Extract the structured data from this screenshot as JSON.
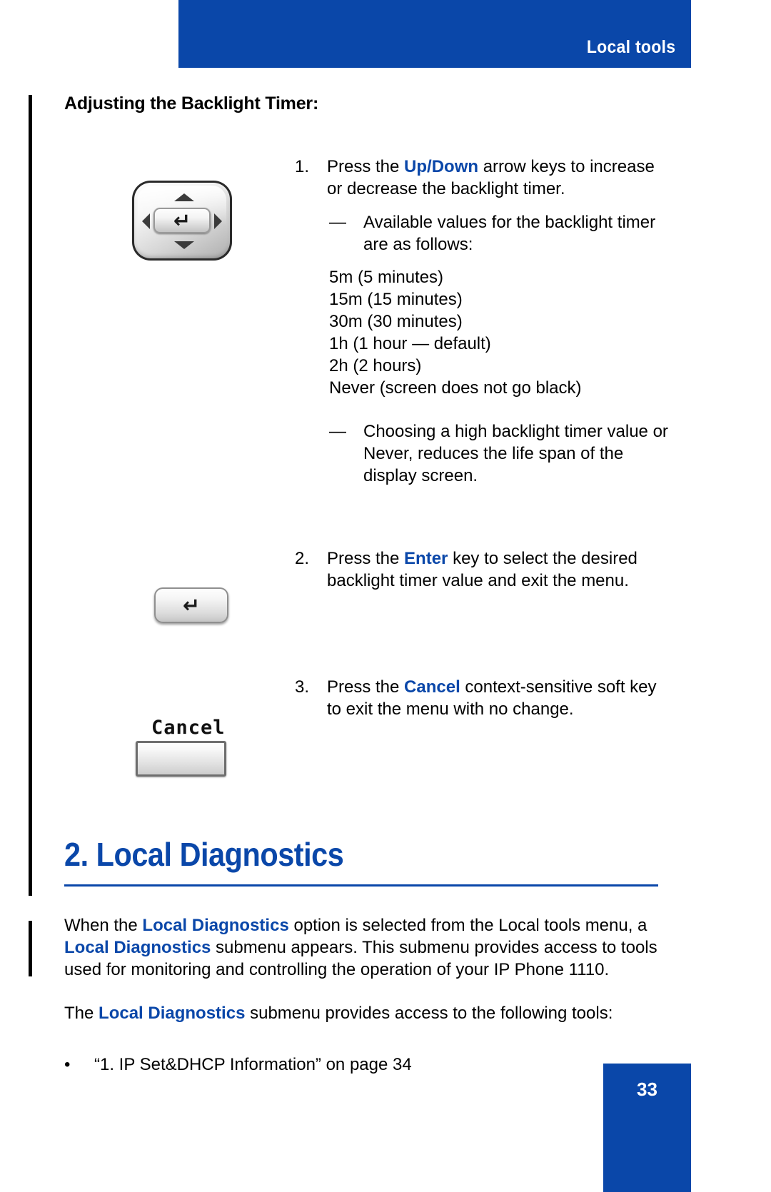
{
  "header": {
    "title": "Local tools",
    "bar_color": "#0a47a9"
  },
  "sub_heading": "Adjusting the Backlight Timer:",
  "steps": [
    {
      "number": "1.",
      "text_before": "Press the ",
      "highlight": "Up/Down",
      "text_after": " arrow keys to increase or decrease the backlight timer."
    },
    {
      "number": "2.",
      "text_before": "Press the ",
      "highlight": "Enter",
      "text_after": " key to select the desired backlight timer value and exit the menu."
    },
    {
      "number": "3.",
      "text_before": "Press the ",
      "highlight": "Cancel",
      "text_after": " context-sensitive soft key to exit the menu with no change."
    }
  ],
  "dash_notes": [
    {
      "mark": "—",
      "text": "Available values for the backlight timer are as follows:"
    },
    {
      "mark": "—",
      "text": "Choosing a high backlight timer value or Never, reduces the life span of the display screen."
    }
  ],
  "backlight_values": "5m (5 minutes)\n15m (15 minutes)\n30m (30 minutes)\n1h (1 hour — default)\n2h (2 hours)\nNever (screen does not go black)",
  "graphics": {
    "nav_cluster_name": "navigation-cluster-key-image",
    "enter_key_glyph": "↵",
    "cancel_softkey_label": "Cancel"
  },
  "section": {
    "heading": "2. Local Diagnostics",
    "paragraph1": {
      "p1": "When the ",
      "b1": "Local Diagnostics",
      "p2": " option is selected from the Local tools menu, a ",
      "b2": "Local Diagnostics",
      "p3": " submenu appears. This submenu provides access to tools used for monitoring and controlling the operation of your IP Phone 1110."
    },
    "paragraph2": {
      "p1": "The ",
      "b1": "Local Diagnostics",
      "p2": " submenu provides access to the following tools:"
    },
    "bullets": [
      {
        "mark": "•",
        "text": "“1. IP Set&DHCP Information” on page 34"
      }
    ]
  },
  "footer": {
    "page_number": "33"
  }
}
